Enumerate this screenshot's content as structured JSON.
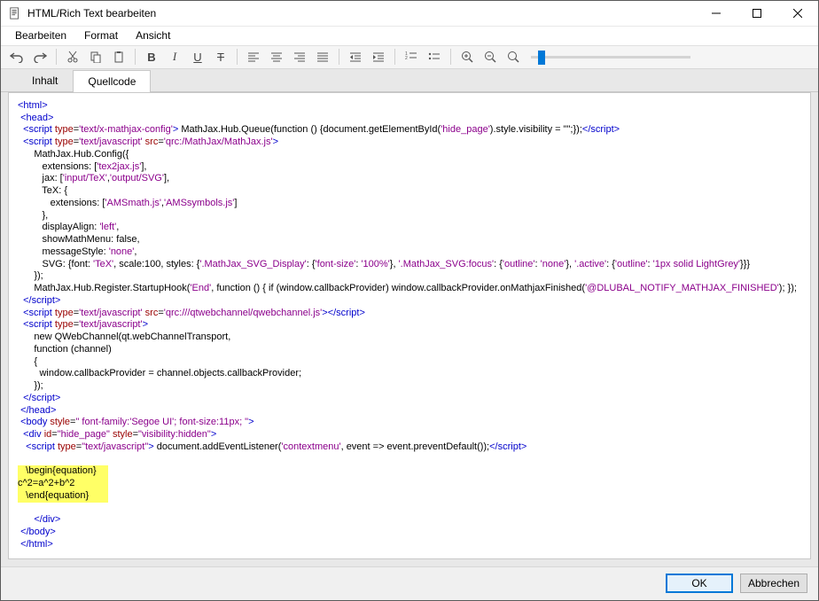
{
  "window": {
    "title": "HTML/Rich Text bearbeiten"
  },
  "menubar": {
    "edit": "Bearbeiten",
    "format": "Format",
    "view": "Ansicht"
  },
  "tabs": {
    "content": "Inhalt",
    "source": "Quellcode"
  },
  "code": {
    "l01_open_html": "<html>",
    "l02_open_head": "<head>",
    "l03_script": "<script",
    "l03_type_n": "type",
    "l03_type_v": "'text/x-mathjax-config'",
    "l03_body": " MathJax.Hub.Queue(function () {document.getElementById(",
    "l03_arg": "'hide_page'",
    "l03_body2": ").style.visibility = \"\";});",
    "l03_close": "</script>",
    "l04_script": "<script",
    "l04_type_n": "type",
    "l04_type_v": "'text/javascript'",
    "l04_src_n": "src",
    "l04_src_v": "'qrc:/MathJax/MathJax.js'",
    "l05": "      MathJax.Hub.Config({",
    "l06a": "         extensions: [",
    "l06b": "'tex2jax.js'",
    "l06c": "],",
    "l07a": "         jax: [",
    "l07b": "'input/TeX'",
    "l07c": ",",
    "l07d": "'output/SVG'",
    "l07e": "],",
    "l08": "         TeX: {",
    "l09a": "            extensions: [",
    "l09b": "'AMSmath.js'",
    "l09c": ",",
    "l09d": "'AMSsymbols.js'",
    "l09e": "]",
    "l10": "         },",
    "l11a": "         displayAlign: ",
    "l11b": "'left'",
    "l11c": ",",
    "l12": "         showMathMenu: false,",
    "l13a": "         messageStyle: ",
    "l13b": "'none'",
    "l13c": ",",
    "l14a": "         SVG: {font: ",
    "l14b": "'TeX'",
    "l14c": ", scale:100, styles: {",
    "l14d": "'.MathJax_SVG_Display'",
    "l14e": ": {",
    "l14f": "'font-size'",
    "l14g": ": ",
    "l14h": "'100%'",
    "l14i": "}, ",
    "l14j": "'.MathJax_SVG:focus'",
    "l14k": ": {",
    "l14l": "'outline'",
    "l14m": ": ",
    "l14n": "'none'",
    "l14o": "}, ",
    "l14p": "'.active'",
    "l14q": ": {",
    "l14r": "'outline'",
    "l14s": ": ",
    "l14t": "'1px solid LightGrey'",
    "l14u": "}}}",
    "l15": "      });",
    "l16a": "      MathJax.Hub.Register.StartupHook(",
    "l16b": "'End'",
    "l16c": ", function () { if (window.callbackProvider) window.callbackProvider.onMathjaxFinished(",
    "l16d": "'@DLUBAL_NOTIFY_MATHJAX_FINISHED'",
    "l16e": "); });",
    "l17": "</script>",
    "l18_script": "<script",
    "l18_type_n": "type",
    "l18_type_v": "'text/javascript'",
    "l18_src_n": "src",
    "l18_src_v": "'qrc:///qtwebchannel/qwebchannel.js'",
    "l18_close": "</script>",
    "l19_script": "<script",
    "l19_type_n": "type",
    "l19_type_v": "'text/javascript'",
    "l20": "      new QWebChannel(qt.webChannelTransport,",
    "l21": "      function (channel)",
    "l22": "      {",
    "l23": "        window.callbackProvider = channel.objects.callbackProvider;",
    "l24": "      });",
    "l25": "</script>",
    "l26": "</head>",
    "l27_body": "<body",
    "l27_style_n": "style",
    "l27_style_v": "\" font-family:'Segoe UI'; font-size:11px; \"",
    "l28_div": "<div",
    "l28_id_n": "id",
    "l28_id_v": "\"hide_page\"",
    "l28_style_n": "style",
    "l28_style_v": "\"visibility:hidden\"",
    "l29_script": "<script",
    "l29_type_n": "type",
    "l29_type_v": "\"text/javascript\"",
    "l29_body": " document.addEventListener(",
    "l29_arg": "'contextmenu'",
    "l29_body2": ", event => event.preventDefault());",
    "l29_close": "</script>",
    "l30": "   \\begin{equation}",
    "l31": "c^2=a^2+b^2",
    "l32": "   \\end{equation}",
    "l33": "</div>",
    "l34": "</body>",
    "l35": "</html>"
  },
  "buttons": {
    "ok": "OK",
    "cancel": "Abbrechen"
  }
}
